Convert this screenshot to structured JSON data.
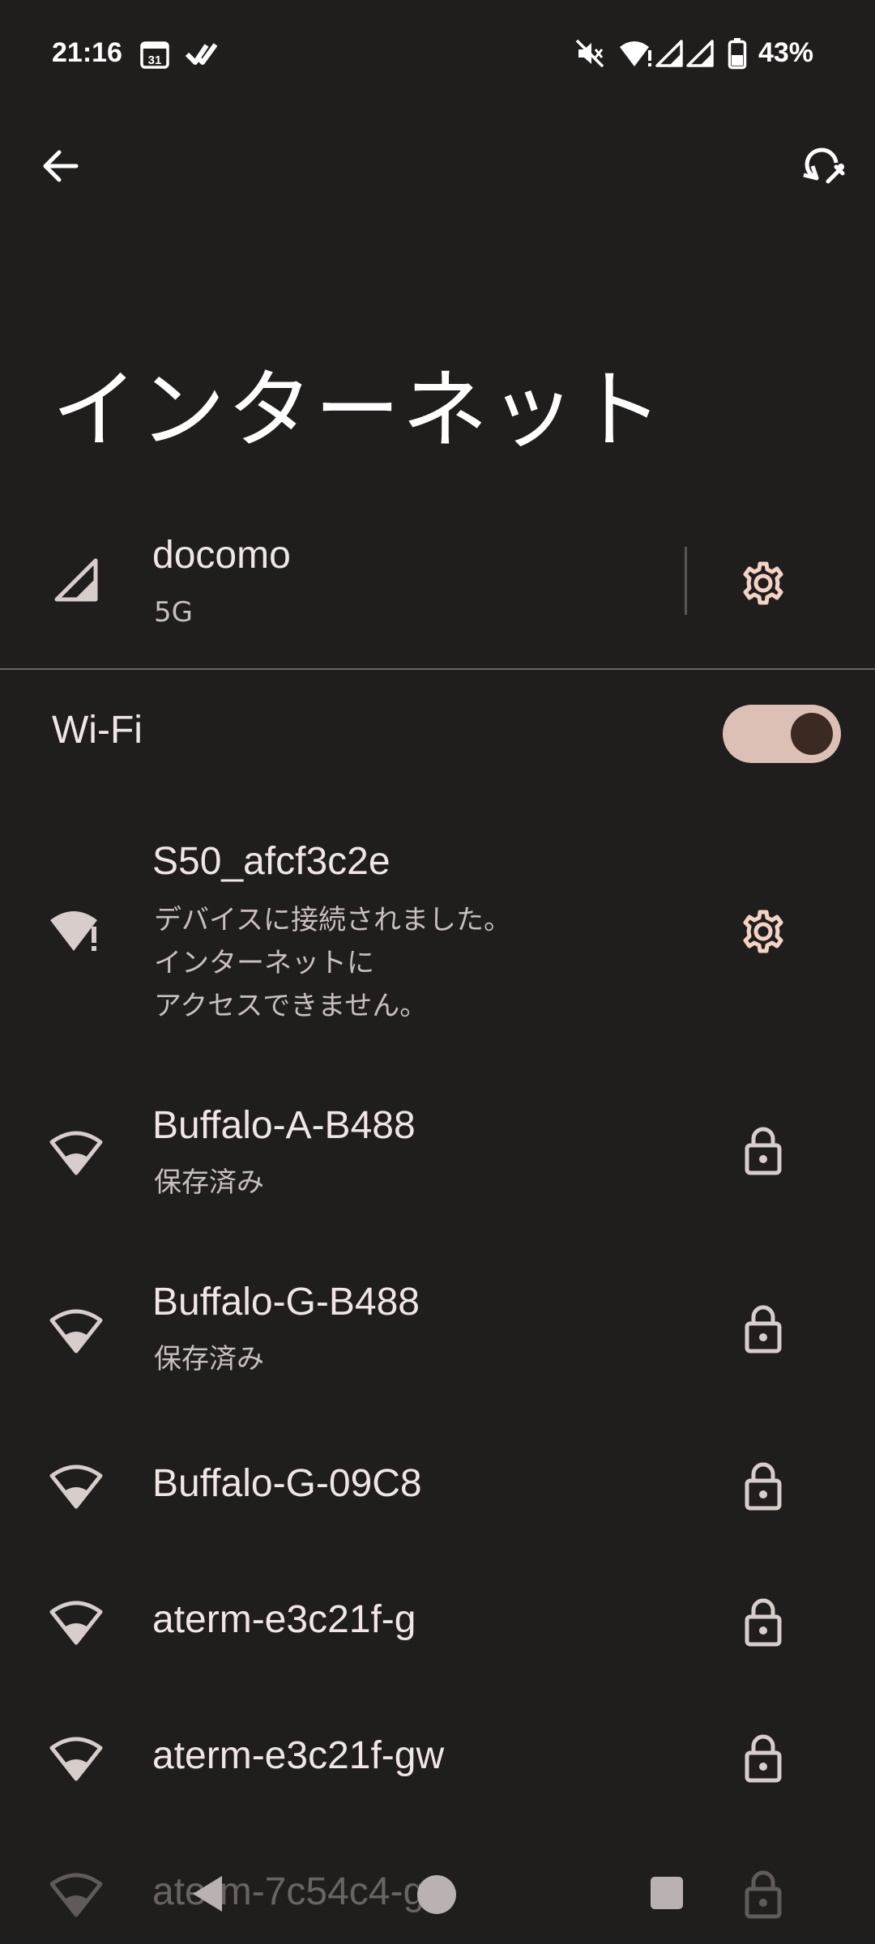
{
  "status_bar": {
    "time": "21:16",
    "battery": "43%",
    "icons": [
      "calendar-icon",
      "check-icon",
      "mute-icon",
      "wifi-alert-icon",
      "signal-icon",
      "signal-icon",
      "battery-icon"
    ]
  },
  "toolbar": {
    "back_icon": "arrow-back-icon",
    "reset_icon": "network-reset-icon"
  },
  "page": {
    "title": "インターネット"
  },
  "mobile": {
    "carrier": "docomo",
    "network_type": "5G"
  },
  "wifi": {
    "label": "Wi-Fi",
    "enabled": true
  },
  "networks": [
    {
      "ssid": "S50_afcf3c2e",
      "status_lines": [
        "デバイスに接続されました。",
        "インターネットに",
        "アクセスできません。"
      ],
      "icon": "wifi-alert-icon",
      "action_icon": "gear-icon"
    },
    {
      "ssid": "Buffalo-A-B488",
      "status": "保存済み",
      "icon": "wifi-icon",
      "action_icon": "lock-icon"
    },
    {
      "ssid": "Buffalo-G-B488",
      "status": "保存済み",
      "icon": "wifi-icon",
      "action_icon": "lock-icon"
    },
    {
      "ssid": "Buffalo-G-09C8",
      "icon": "wifi-icon",
      "action_icon": "lock-icon"
    },
    {
      "ssid": "aterm-e3c21f-g",
      "icon": "wifi-icon",
      "action_icon": "lock-icon"
    },
    {
      "ssid": "aterm-e3c21f-gw",
      "icon": "wifi-icon",
      "action_icon": "lock-icon"
    },
    {
      "ssid": "aterm-7c54c4-g",
      "icon": "wifi-icon",
      "action_icon": "lock-icon"
    }
  ],
  "nav_bar": {
    "icons": [
      "back-triangle-icon",
      "home-circle-icon",
      "recents-square-icon"
    ]
  },
  "colors": {
    "background": "#201d1d",
    "accent": "#dcc0b6",
    "text_primary": "#f0e6e4",
    "text_secondary": "#c9bfbd"
  }
}
